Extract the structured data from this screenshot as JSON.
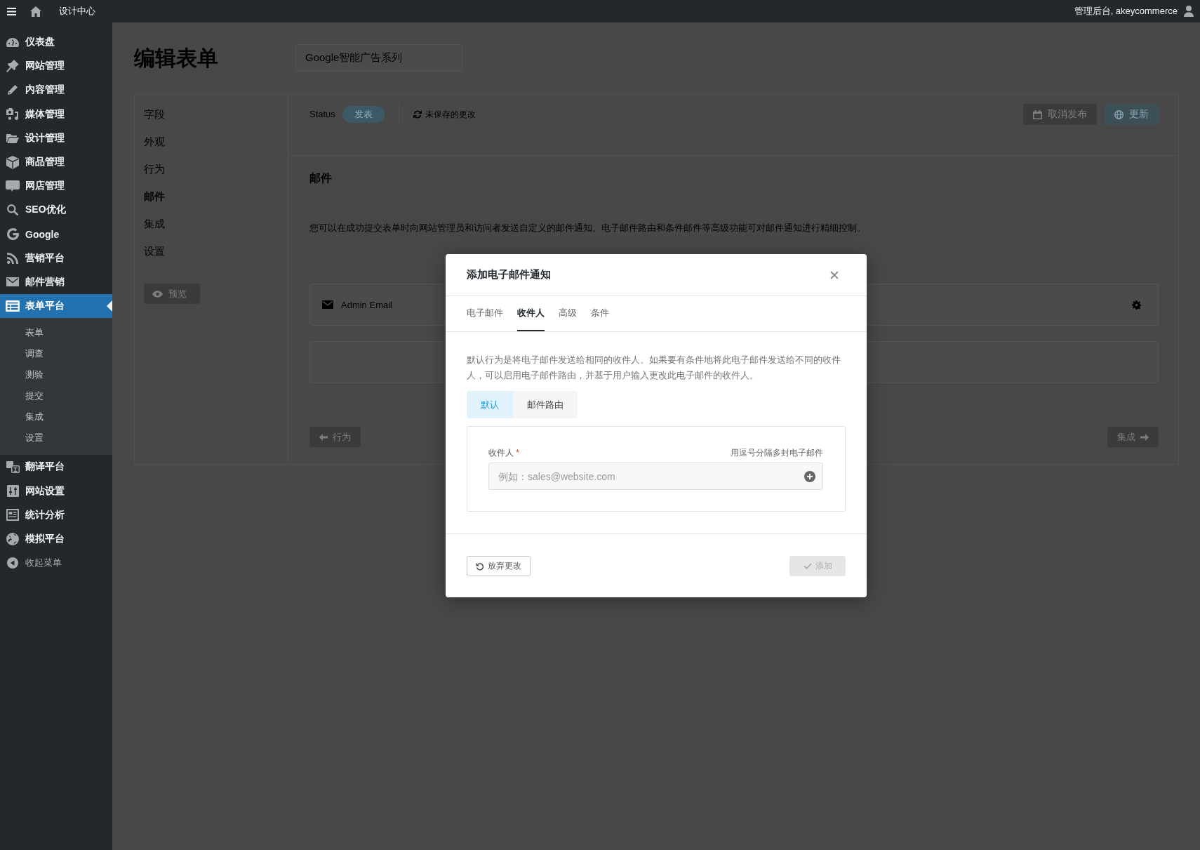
{
  "top_bar": {
    "site_title": "设计中心",
    "account_label": "管理后台, akeycommerce"
  },
  "sidebar": {
    "items": [
      {
        "label": "仪表盘",
        "selected": false
      },
      {
        "label": "网站管理",
        "selected": false
      },
      {
        "label": "内容管理",
        "selected": false
      },
      {
        "label": "媒体管理",
        "selected": false
      },
      {
        "label": "设计管理",
        "selected": false
      },
      {
        "label": "商品管理",
        "selected": false
      },
      {
        "label": "网店管理",
        "selected": false
      },
      {
        "label": "SEO优化",
        "selected": false
      },
      {
        "label": "Google",
        "selected": false
      },
      {
        "label": "营销平台",
        "selected": false
      },
      {
        "label": "邮件营销",
        "selected": false
      },
      {
        "label": "表单平台",
        "selected": true,
        "children": [
          {
            "label": "表单",
            "selected": false
          },
          {
            "label": "调查",
            "selected": false
          },
          {
            "label": "测验",
            "selected": false
          },
          {
            "label": "提交",
            "selected": false
          },
          {
            "label": "集成",
            "selected": false
          },
          {
            "label": "设置",
            "selected": false
          }
        ]
      },
      {
        "label": "翻译平台",
        "selected": false
      },
      {
        "label": "网站设置",
        "selected": false
      },
      {
        "label": "统计分析",
        "selected": false
      },
      {
        "label": "模拟平台",
        "selected": false
      }
    ],
    "collapse_label": "收起菜单"
  },
  "page": {
    "title": "编辑表单",
    "form_name_field": {
      "value": "Google智能广告系列"
    },
    "nav": [
      {
        "label": "字段",
        "selected": false
      },
      {
        "label": "外观",
        "selected": false
      },
      {
        "label": "行为",
        "selected": false
      },
      {
        "label": "邮件",
        "selected": true
      },
      {
        "label": "集成",
        "selected": false
      },
      {
        "label": "设置",
        "selected": false
      }
    ],
    "preview_button": "预览",
    "status_label": "Status",
    "status_value": "发表",
    "unsaved_notice": "未保存的更改",
    "unpublish_button": "取消发布",
    "update_button": "更新",
    "section_title": "邮件",
    "section_description": "您可以在成功提交表单时向网站管理员和访问者发送自定义的邮件通知。电子邮件路由和条件邮件等高级功能可对邮件通知进行精细控制。",
    "notifications": [
      {
        "name": "Admin Email"
      }
    ],
    "prev_button": "行为",
    "next_button": "集成"
  },
  "dialog": {
    "title": "添加电子邮件通知",
    "tabs": [
      {
        "label": "电子邮件",
        "selected": false
      },
      {
        "label": "收件人",
        "selected": true
      },
      {
        "label": "高级",
        "selected": false
      },
      {
        "label": "条件",
        "selected": false
      }
    ],
    "description": "默认行为是将电子邮件发送给相同的收件人。如果要有条件地将此电子邮件发送给不同的收件人，可以启用电子邮件路由，并基于用户输入更改此电子邮件的收件人。",
    "mode_options": [
      {
        "label": "默认",
        "selected": true
      },
      {
        "label": "邮件路由",
        "selected": false
      }
    ],
    "recipient": {
      "label": "收件人",
      "required_mark": "*",
      "hint": "用逗号分隔多封电子邮件",
      "placeholder": "例如：sales@website.com"
    },
    "discard_button": "放弃更改",
    "add_button": {
      "label": "添加",
      "disabled": true
    }
  }
}
